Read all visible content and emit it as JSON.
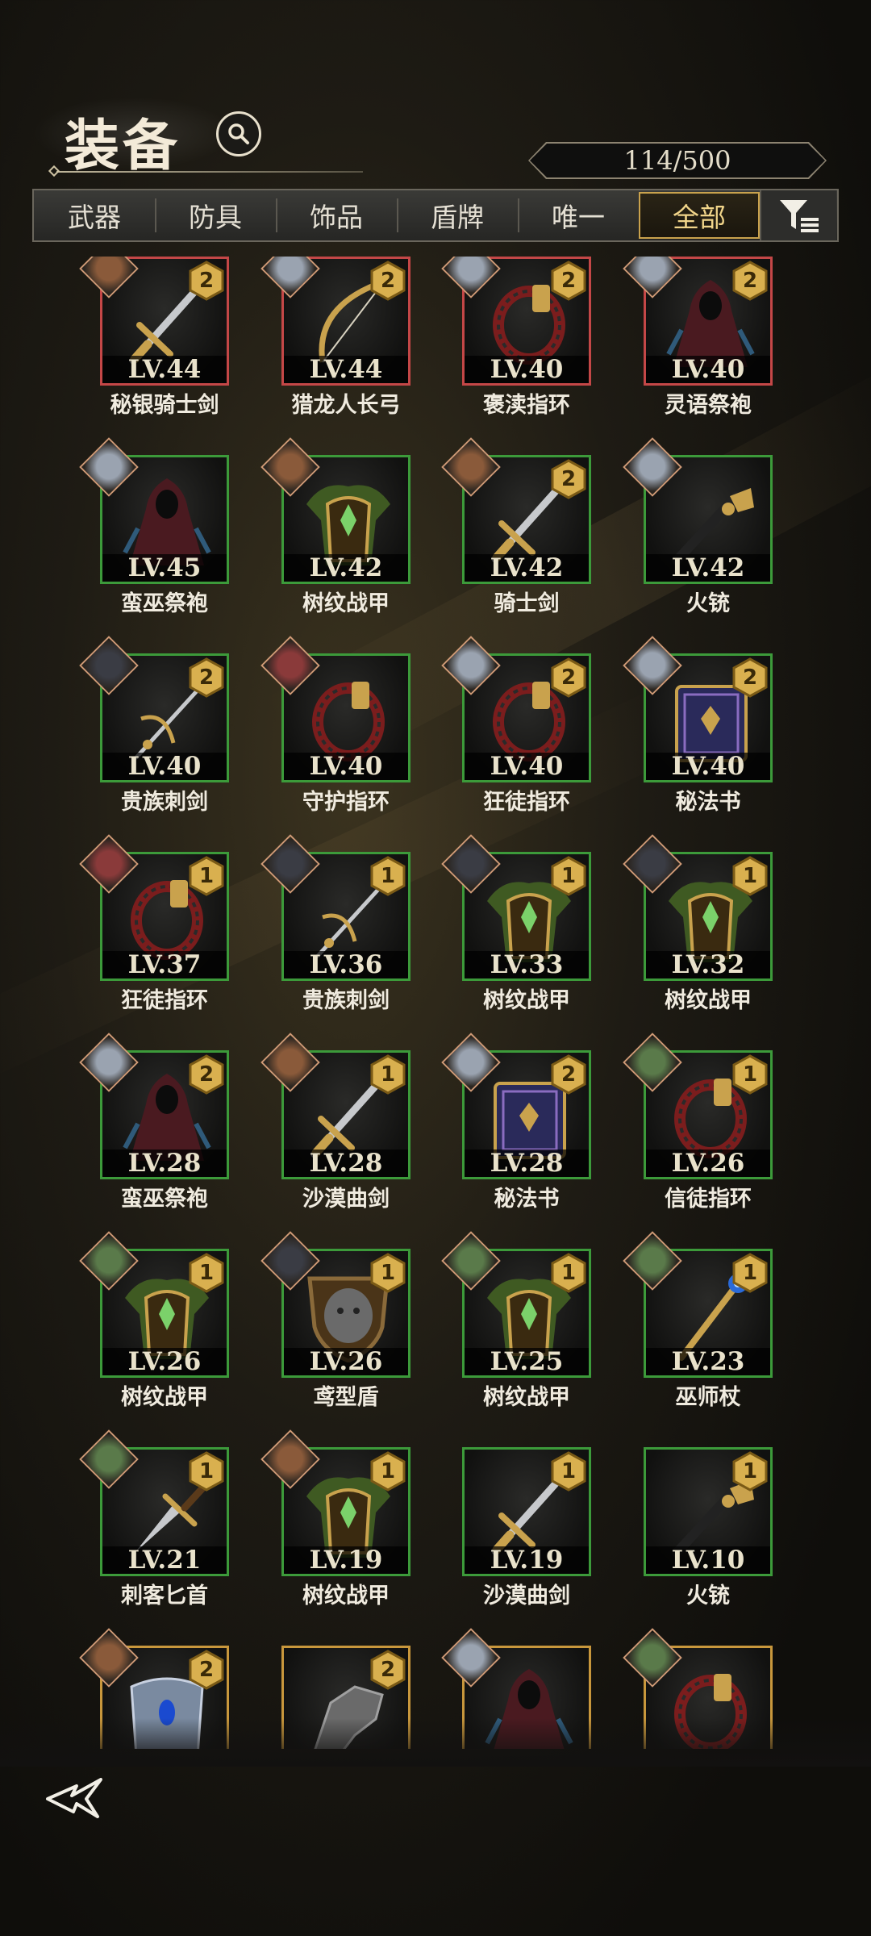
{
  "header": {
    "title": "装备",
    "capacity": "114/500"
  },
  "tabs": [
    {
      "label": "武器",
      "active": false
    },
    {
      "label": "防具",
      "active": false
    },
    {
      "label": "饰品",
      "active": false
    },
    {
      "label": "盾牌",
      "active": false
    },
    {
      "label": "唯一",
      "active": false
    },
    {
      "label": "全部",
      "active": true
    }
  ],
  "colors": {
    "rarity_red": "#c44747",
    "rarity_green": "#3c9a3a",
    "rarity_gold": "#c8973c",
    "accent": "#c9a24d"
  },
  "items": [
    {
      "name": "秘银骑士剑",
      "level": "LV.44",
      "tier": "2",
      "rarity": "red",
      "icon": "sword-icon",
      "portrait": "brown"
    },
    {
      "name": "猎龙人长弓",
      "level": "LV.44",
      "tier": "2",
      "rarity": "red",
      "icon": "bow-icon",
      "portrait": "silver"
    },
    {
      "name": "褒渎指环",
      "level": "LV.40",
      "tier": "2",
      "rarity": "red",
      "icon": "ring-icon",
      "portrait": "silver"
    },
    {
      "name": "灵语祭袍",
      "level": "LV.40",
      "tier": "2",
      "rarity": "red",
      "icon": "robe-icon",
      "portrait": "silver"
    },
    {
      "name": "蛮巫祭袍",
      "level": "LV.45",
      "tier": "",
      "rarity": "green",
      "icon": "robe-icon",
      "portrait": "silver"
    },
    {
      "name": "树纹战甲",
      "level": "LV.42",
      "tier": "",
      "rarity": "green",
      "icon": "armor-icon",
      "portrait": "brown"
    },
    {
      "name": "骑士剑",
      "level": "LV.42",
      "tier": "2",
      "rarity": "green",
      "icon": "sword-icon",
      "portrait": "brown"
    },
    {
      "name": "火铳",
      "level": "LV.42",
      "tier": "",
      "rarity": "green",
      "icon": "gun-icon",
      "portrait": "silver"
    },
    {
      "name": "贵族刺剑",
      "level": "LV.40",
      "tier": "2",
      "rarity": "green",
      "icon": "rapier-icon",
      "portrait": "dark"
    },
    {
      "name": "守护指环",
      "level": "LV.40",
      "tier": "",
      "rarity": "green",
      "icon": "ring-icon",
      "portrait": "red"
    },
    {
      "name": "狂徒指环",
      "level": "LV.40",
      "tier": "2",
      "rarity": "green",
      "icon": "ring-icon",
      "portrait": "silver"
    },
    {
      "name": "秘法书",
      "level": "LV.40",
      "tier": "2",
      "rarity": "green",
      "icon": "book-icon",
      "portrait": "silver"
    },
    {
      "name": "狂徒指环",
      "level": "LV.37",
      "tier": "1",
      "rarity": "green",
      "icon": "ring-icon",
      "portrait": "red"
    },
    {
      "name": "贵族刺剑",
      "level": "LV.36",
      "tier": "1",
      "rarity": "green",
      "icon": "rapier-icon",
      "portrait": "dark"
    },
    {
      "name": "树纹战甲",
      "level": "LV.33",
      "tier": "1",
      "rarity": "green",
      "icon": "armor-icon",
      "portrait": "dark"
    },
    {
      "name": "树纹战甲",
      "level": "LV.32",
      "tier": "1",
      "rarity": "green",
      "icon": "armor-icon",
      "portrait": "dark"
    },
    {
      "name": "蛮巫祭袍",
      "level": "LV.28",
      "tier": "2",
      "rarity": "green",
      "icon": "robe-icon",
      "portrait": "silver"
    },
    {
      "name": "沙漠曲剑",
      "level": "LV.28",
      "tier": "1",
      "rarity": "green",
      "icon": "sword-icon",
      "portrait": "brown"
    },
    {
      "name": "秘法书",
      "level": "LV.28",
      "tier": "2",
      "rarity": "green",
      "icon": "book-icon",
      "portrait": "silver"
    },
    {
      "name": "信徒指环",
      "level": "LV.26",
      "tier": "1",
      "rarity": "green",
      "icon": "ring-icon",
      "portrait": "green"
    },
    {
      "name": "树纹战甲",
      "level": "LV.26",
      "tier": "1",
      "rarity": "green",
      "icon": "armor-icon",
      "portrait": "green"
    },
    {
      "name": "鸢型盾",
      "level": "LV.26",
      "tier": "1",
      "rarity": "green",
      "icon": "shield-icon",
      "portrait": "dark"
    },
    {
      "name": "树纹战甲",
      "level": "LV.25",
      "tier": "1",
      "rarity": "green",
      "icon": "armor-icon",
      "portrait": "green"
    },
    {
      "name": "巫师杖",
      "level": "LV.23",
      "tier": "1",
      "rarity": "green",
      "icon": "staff-icon",
      "portrait": "green"
    },
    {
      "name": "刺客匕首",
      "level": "LV.21",
      "tier": "1",
      "rarity": "green",
      "icon": "dagger-icon",
      "portrait": "green"
    },
    {
      "name": "树纹战甲",
      "level": "LV.19",
      "tier": "1",
      "rarity": "green",
      "icon": "armor-icon",
      "portrait": "brown"
    },
    {
      "name": "沙漠曲剑",
      "level": "LV.19",
      "tier": "1",
      "rarity": "green",
      "icon": "sword-icon",
      "portrait": ""
    },
    {
      "name": "火铳",
      "level": "LV.10",
      "tier": "1",
      "rarity": "green",
      "icon": "gun-icon",
      "portrait": ""
    },
    {
      "name": "",
      "level": "",
      "tier": "2",
      "rarity": "gold",
      "icon": "bracer-icon",
      "portrait": "brown"
    },
    {
      "name": "",
      "level": "",
      "tier": "2",
      "rarity": "gold",
      "icon": "gauntlet-icon",
      "portrait": ""
    },
    {
      "name": "",
      "level": "",
      "tier": "",
      "rarity": "gold",
      "icon": "robe-icon",
      "portrait": "silver"
    },
    {
      "name": "",
      "level": "",
      "tier": "",
      "rarity": "gold",
      "icon": "ring-icon",
      "portrait": "green"
    }
  ]
}
